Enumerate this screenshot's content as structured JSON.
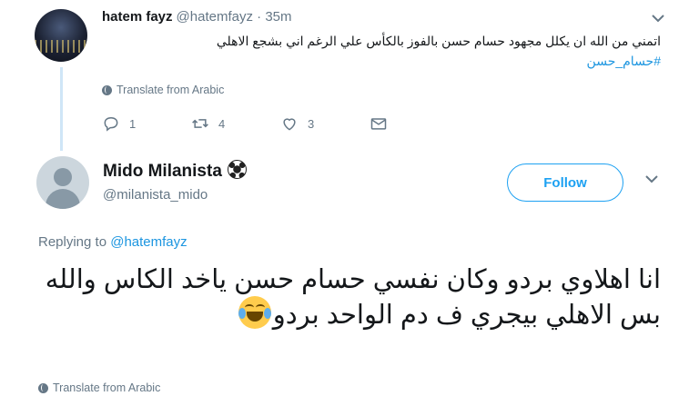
{
  "parent_tweet": {
    "author_name": "hatem fayz",
    "author_handle": "@hatemfayz",
    "separator": "·",
    "time": "35m",
    "text": "اتمني من الله ان يكلل مجهود حسام حسن بالفوز بالكأس علي الرغم اني بشجع الاهلي",
    "hashtag": "#حسام_حسن",
    "translate_label": "Translate from Arabic",
    "actions": {
      "reply_count": "1",
      "retweet_count": "4",
      "like_count": "3"
    }
  },
  "reply_tweet": {
    "author_name": "Mido Milanista",
    "author_handle": "@milanista_mido",
    "follow_label": "Follow",
    "replying_prefix": "Replying to",
    "replying_to": "@hatemfayz",
    "text_line1": "انا اهلاوي بردو وكان نفسي حسام حسن ياخد الكاس والله",
    "text_line2": "بس الاهلي بيجري ف دم الواحد بردو",
    "translate_label": "Translate from Arabic"
  },
  "colors": {
    "accent": "#1da1f2",
    "link": "#1b95e0",
    "muted": "#657786",
    "thread_line": "#cfe6f7"
  },
  "icons": [
    "globe-icon",
    "reply-icon",
    "retweet-icon",
    "like-icon",
    "message-icon",
    "chevron-down-icon",
    "soccer-ball-emoji",
    "laughing-tears-emoji"
  ]
}
